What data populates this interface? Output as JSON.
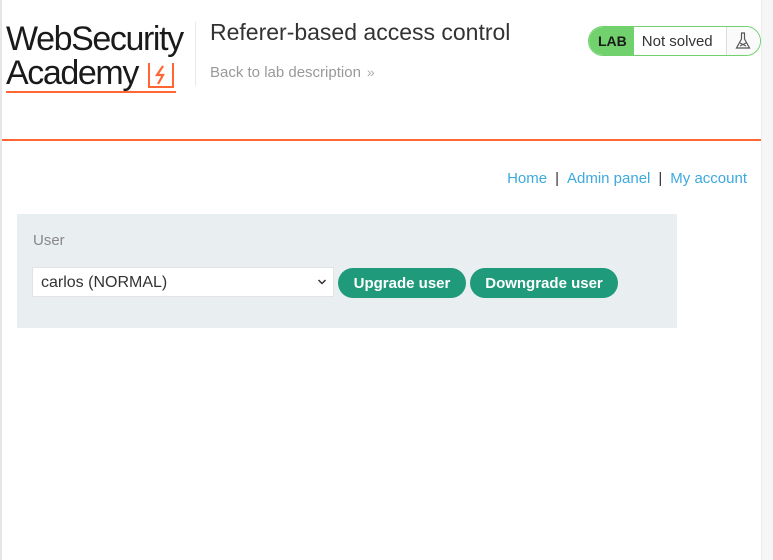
{
  "logo": {
    "line1": "WebSecurity",
    "line2": "Academy",
    "alt": "Web Security Academy logo"
  },
  "lab": {
    "title": "Referer-based access control",
    "back_link": "Back to lab description",
    "back_chevron": "»",
    "badge": "LAB",
    "status": "Not solved"
  },
  "nav": {
    "home": "Home",
    "admin": "Admin panel",
    "account": "My account",
    "separator": "|"
  },
  "panel": {
    "label": "User",
    "selected_user": "carlos (NORMAL)",
    "upgrade_label": "Upgrade user",
    "downgrade_label": "Downgrade user"
  },
  "colors": {
    "accent": "#ff6633",
    "lab_green": "#70d16d",
    "button": "#1f9a7a",
    "link": "#3da9df",
    "panel_bg": "#e9eef0"
  }
}
